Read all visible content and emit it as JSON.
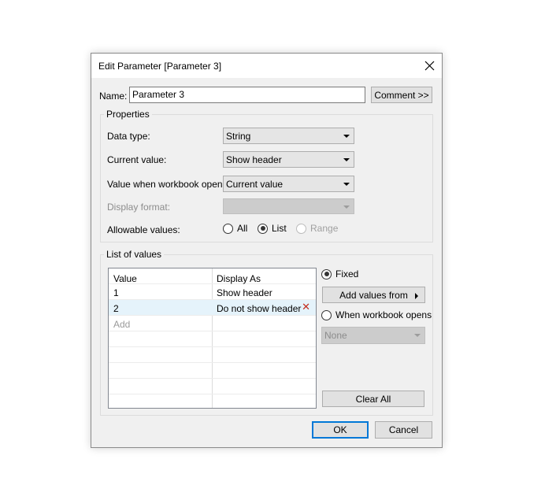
{
  "dialog": {
    "title": "Edit Parameter [Parameter 3]",
    "name_label": "Name:",
    "name_value": "Parameter 3",
    "comment_button": "Comment >>",
    "properties": {
      "title": "Properties",
      "data_type_label": "Data type:",
      "data_type_value": "String",
      "current_value_label": "Current value:",
      "current_value_value": "Show header",
      "workbook_opens_label": "Value when workbook opens:",
      "workbook_opens_value": "Current value",
      "display_format_label": "Display format:",
      "display_format_value": "",
      "allowable_label": "Allowable values:",
      "allowable_options": [
        "All",
        "List",
        "Range"
      ],
      "allowable_selected": "List"
    },
    "list_of_values": {
      "title": "List of values",
      "columns": [
        "Value",
        "Display As"
      ],
      "rows": [
        {
          "value": "1",
          "display": "Show header"
        },
        {
          "value": "2",
          "display": "Do not show header"
        }
      ],
      "add_placeholder": "Add",
      "fixed_label": "Fixed",
      "fixed_selected": true,
      "add_values_button": "Add values from",
      "when_workbook_opens_label": "When workbook opens",
      "workbook_field_value": "None",
      "clear_all_button": "Clear All"
    },
    "ok_button": "OK",
    "cancel_button": "Cancel"
  },
  "colors": {
    "dialog_bg": "#f0f0f0",
    "default_button_border": "#0078d7",
    "selected_row": "#e5f3fb",
    "delete_x": "#c42b1c"
  }
}
